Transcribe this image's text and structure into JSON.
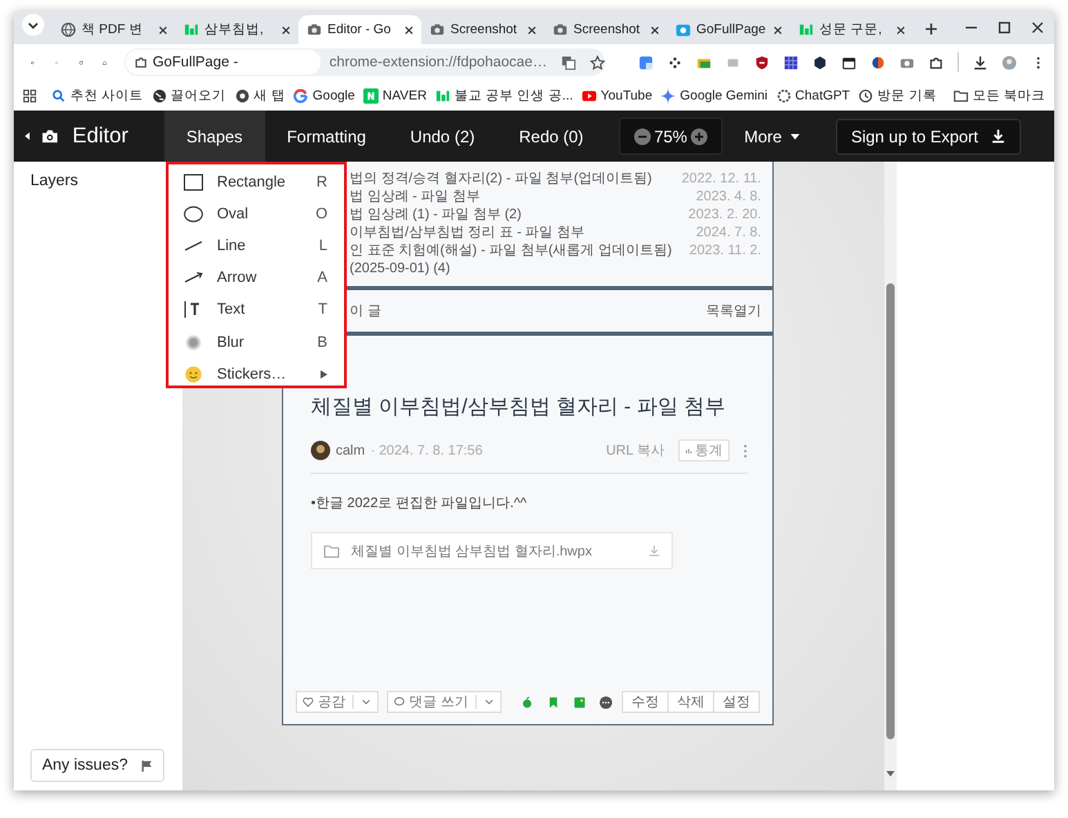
{
  "browser": {
    "tabs": [
      {
        "label": "책 PDF 변",
        "kind": "globe",
        "selected": false
      },
      {
        "label": "삼부침법,",
        "kind": "blog",
        "selected": false
      },
      {
        "label": "Editor - Go",
        "kind": "camera",
        "selected": true
      },
      {
        "label": "Screenshot",
        "kind": "camera",
        "selected": false
      },
      {
        "label": "Screenshot",
        "kind": "camera",
        "selected": false
      },
      {
        "label": "GoFullPage",
        "kind": "gofull",
        "selected": false
      },
      {
        "label": "성문 구문,",
        "kind": "blog",
        "selected": false
      }
    ],
    "site_chip": "GoFullPage -",
    "url": "chrome-extension://fdpohaocae…",
    "bookmarks": [
      {
        "label": "추천 사이트",
        "kind": "search"
      },
      {
        "label": "끌어오기",
        "kind": "globe"
      },
      {
        "label": "새 탭",
        "kind": "chrome"
      },
      {
        "label": "Google",
        "kind": "google"
      },
      {
        "label": "NAVER",
        "kind": "naver"
      },
      {
        "label": "불교 공부 인생 공...",
        "kind": "blog"
      },
      {
        "label": "YouTube",
        "kind": "youtube"
      },
      {
        "label": "Google Gemini",
        "kind": "gemini"
      },
      {
        "label": "ChatGPT",
        "kind": "chatgpt"
      },
      {
        "label": "방문 기록",
        "kind": "history"
      }
    ],
    "all_bookmarks": "모든 북마크"
  },
  "editor": {
    "title": "Editor",
    "menus": [
      {
        "label": "Shapes",
        "selected": true
      },
      {
        "label": "Formatting",
        "selected": false
      },
      {
        "label": "Undo (2)",
        "selected": false
      },
      {
        "label": "Redo (0)",
        "selected": false
      }
    ],
    "zoom": "75%",
    "more": "More",
    "export": "Sign up to Export"
  },
  "shapes_menu": [
    {
      "label": "Rectangle",
      "shortcut": "R",
      "kind": "rectangle"
    },
    {
      "label": "Oval",
      "shortcut": "O",
      "kind": "oval"
    },
    {
      "label": "Line",
      "shortcut": "L",
      "kind": "line"
    },
    {
      "label": "Arrow",
      "shortcut": "A",
      "kind": "arrow"
    },
    {
      "label": "Text",
      "shortcut": "T",
      "kind": "text"
    },
    {
      "label": "Blur",
      "shortcut": "B",
      "kind": "blur"
    },
    {
      "label": "Stickers…",
      "kind": "stickers",
      "submenu": true
    }
  ],
  "sidebar": {
    "title": "Layers",
    "issues_button": "Any issues?"
  },
  "captured_page": {
    "rows": [
      {
        "title": "법의 정격/승격 혈자리(2) - 파일 첨부(업데이트됨)",
        "date": "2022. 12. 11."
      },
      {
        "title": "법 임상례 - 파일 첨부",
        "date": "2023. 4. 8."
      },
      {
        "title": "법 임상례 (1) - 파일 첨부 (2)",
        "date": "2023. 2. 20."
      },
      {
        "title": "이부침법/삼부침법 정리 표 - 파일 첨부",
        "date": "2024. 7. 8."
      },
      {
        "title": "인 표준 치험예(해설) - 파일 첨부(새롭게 업데이트됨) (2025-09-01) (4)",
        "date": "2023. 11. 2."
      }
    ],
    "current_label": "이 글",
    "list_toggle": "목록열기",
    "post_title": "체질별 이부침법/삼부침법 혈자리 - 파일 첨부",
    "author": "calm",
    "date": "· 2024. 7. 8. 17:56",
    "url_copy": "URL 복사",
    "stats": "통계",
    "body": "•한글 2022로 편집한 파일입니다.^^",
    "file": "체질별 이부침법 삼부침법 혈자리.hwpx",
    "like": "공감",
    "comment": "댓글 쓰기",
    "actions": [
      "수정",
      "삭제",
      "설정"
    ]
  }
}
